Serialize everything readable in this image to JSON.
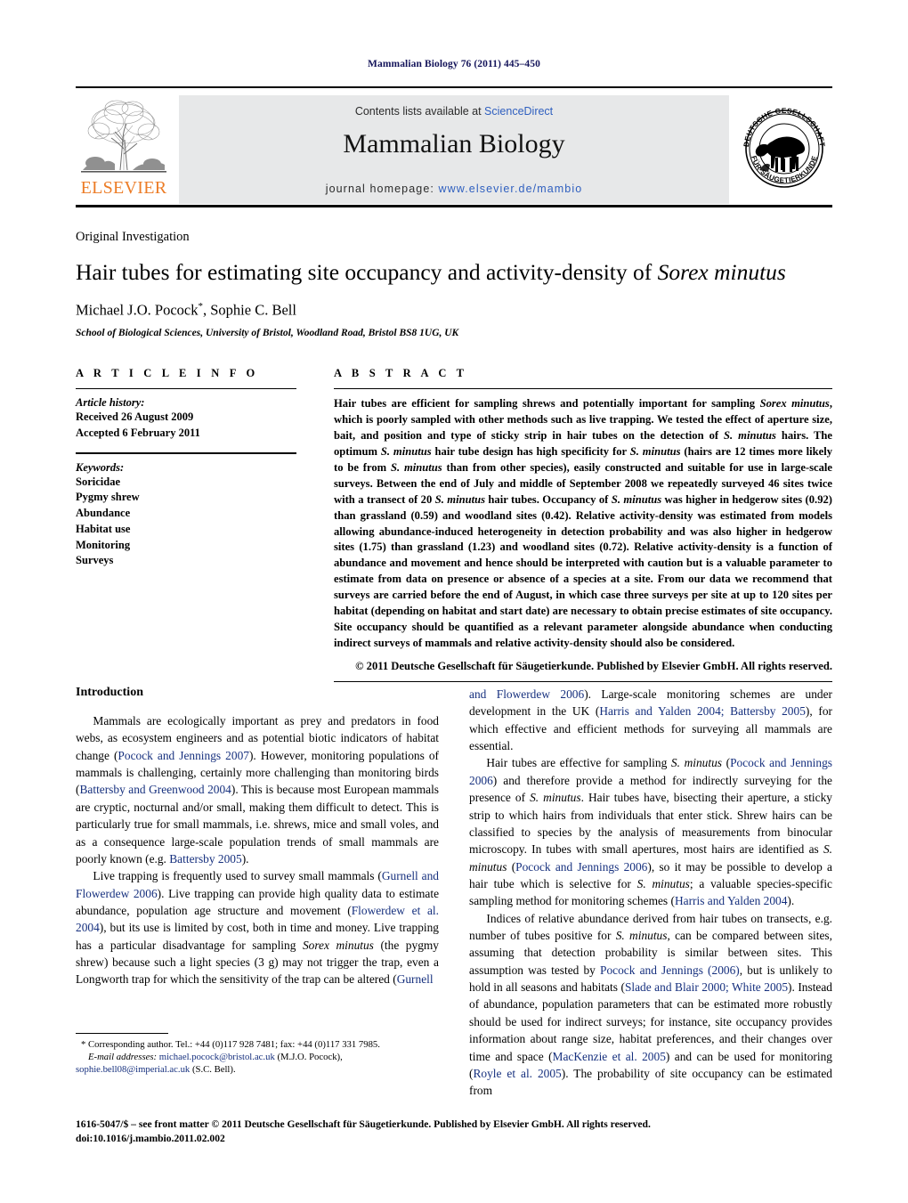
{
  "running_head": "Mammalian Biology 76 (2011) 445–450",
  "masthead": {
    "contents_prefix": "Contents lists available at ",
    "contents_link": "ScienceDirect",
    "journal_title": "Mammalian Biology",
    "homepage_prefix": "journal homepage: ",
    "homepage_url": "www.elsevier.de/mambio",
    "publisher_name": "ELSEVIER",
    "publisher_logo_icon": "elsevier-tree-icon",
    "society_logo_icon": "deutsche-gesellschaft-fuer-saeugetierkunde-seal-icon",
    "society_text_top": "DEUTSCHE GESELLSCHAFT",
    "society_text_bottom": "FÜR SÄUGETIERKUNDE",
    "band_color": "#e7e8e9",
    "link_color": "#2f5fbf",
    "elsevier_orange": "#ec7c26"
  },
  "title_block": {
    "article_type": "Original Investigation",
    "title_plain_1": "Hair tubes for estimating site occupancy and activity-density of ",
    "title_italic": "Sorex minutus",
    "authors": "Michael J.O. Pocock",
    "authors_marker": "*",
    "authors_rest": ", Sophie C. Bell",
    "affiliation": "School of Biological Sciences, University of Bristol, Woodland Road, Bristol BS8 1UG, UK"
  },
  "article_info": {
    "heading": "A R T I C L E  I N F O",
    "history_label": "Article history:",
    "history": [
      "Received 26 August 2009",
      "Accepted 6 February 2011"
    ],
    "keywords_label": "Keywords:",
    "keywords": [
      "Soricidae",
      "Pygmy shrew",
      "Abundance",
      "Habitat use",
      "Monitoring",
      "Surveys"
    ]
  },
  "abstract": {
    "heading": "A B S T R A C T",
    "segments": [
      {
        "t": "Hair tubes are efficient for sampling shrews and potentially important for sampling ",
        "i": false
      },
      {
        "t": "Sorex minutus",
        "i": true
      },
      {
        "t": ", which is poorly sampled with other methods such as live trapping. We tested the effect of aperture size, bait, and position and type of sticky strip in hair tubes on the detection of ",
        "i": false
      },
      {
        "t": "S. minutus",
        "i": true
      },
      {
        "t": " hairs. The optimum ",
        "i": false
      },
      {
        "t": "S. minutus",
        "i": true
      },
      {
        "t": " hair tube design has high specificity for ",
        "i": false
      },
      {
        "t": "S. minutus",
        "i": true
      },
      {
        "t": " (hairs are 12 times more likely to be from ",
        "i": false
      },
      {
        "t": "S. minutus",
        "i": true
      },
      {
        "t": " than from other species), easily constructed and suitable for use in large-scale surveys. Between the end of July and middle of September 2008 we repeatedly surveyed 46 sites twice with a transect of 20 ",
        "i": false
      },
      {
        "t": "S. minutus",
        "i": true
      },
      {
        "t": " hair tubes. Occupancy of ",
        "i": false
      },
      {
        "t": "S. minutus",
        "i": true
      },
      {
        "t": " was higher in hedgerow sites (0.92) than grassland (0.59) and woodland sites (0.42). Relative activity-density was estimated from models allowing abundance-induced heterogeneity in detection probability and was also higher in hedgerow sites (1.75) than grassland (1.23) and woodland sites (0.72). Relative activity-density is a function of abundance and movement and hence should be interpreted with caution but is a valuable parameter to estimate from data on presence or absence of a species at a site. From our data we recommend that surveys are carried before the end of August, in which case three surveys per site at up to 120 sites per habitat (depending on habitat and start date) are necessary to obtain precise estimates of site occupancy. Site occupancy should be quantified as a relevant parameter alongside abundance when conducting indirect surveys of mammals and relative activity-density should also be considered.",
        "i": false
      }
    ],
    "copyright": "© 2011 Deutsche Gesellschaft für Säugetierkunde. Published by Elsevier GmbH. All rights reserved."
  },
  "introduction": {
    "heading": "Introduction",
    "left_paragraphs": [
      [
        {
          "t": "Mammals are ecologically important as prey and predators in food webs, as ecosystem engineers and as potential biotic indicators of habitat change (",
          "k": "plain"
        },
        {
          "t": "Pocock and Jennings 2007",
          "k": "cite"
        },
        {
          "t": "). However, monitoring populations of mammals is challenging, certainly more challenging than monitoring birds (",
          "k": "plain"
        },
        {
          "t": "Battersby and Greenwood 2004",
          "k": "cite"
        },
        {
          "t": "). This is because most European mammals are cryptic, nocturnal and/or small, making them difficult to detect. This is particularly true for small mammals, i.e. shrews, mice and small voles, and as a consequence large-scale population trends of small mammals are poorly known (e.g. ",
          "k": "plain"
        },
        {
          "t": "Battersby 2005",
          "k": "cite"
        },
        {
          "t": ").",
          "k": "plain"
        }
      ],
      [
        {
          "t": "Live trapping is frequently used to survey small mammals (",
          "k": "plain"
        },
        {
          "t": "Gurnell and Flowerdew 2006",
          "k": "cite"
        },
        {
          "t": "). Live trapping can provide high quality data to estimate abundance, population age structure and movement (",
          "k": "plain"
        },
        {
          "t": "Flowerdew et al. 2004",
          "k": "cite"
        },
        {
          "t": "), but its use is limited by cost, both in time and money. Live trapping has a particular disadvantage for sampling ",
          "k": "plain"
        },
        {
          "t": "Sorex minutus",
          "k": "italic"
        },
        {
          "t": " (the pygmy shrew) because such a light species (3 g) may not trigger the trap, even a Longworth trap for which the sensitivity of the trap can be altered (",
          "k": "plain"
        },
        {
          "t": "Gurnell",
          "k": "cite"
        }
      ]
    ],
    "right_paragraphs": [
      [
        {
          "t": "and Flowerdew 2006",
          "k": "cite"
        },
        {
          "t": "). Large-scale monitoring schemes are under development in the UK (",
          "k": "plain"
        },
        {
          "t": "Harris and Yalden 2004; Battersby 2005",
          "k": "cite"
        },
        {
          "t": "), for which effective and efficient methods for surveying all mammals are essential.",
          "k": "plain"
        }
      ],
      [
        {
          "t": "Hair tubes are effective for sampling ",
          "k": "plain"
        },
        {
          "t": "S. minutus",
          "k": "italic"
        },
        {
          "t": " (",
          "k": "plain"
        },
        {
          "t": "Pocock and Jennings 2006",
          "k": "cite"
        },
        {
          "t": ") and therefore provide a method for indirectly surveying for the presence of ",
          "k": "plain"
        },
        {
          "t": "S. minutus",
          "k": "italic"
        },
        {
          "t": ". Hair tubes have, bisecting their aperture, a sticky strip to which hairs from individuals that enter stick. Shrew hairs can be classified to species by the analysis of measurements from binocular microscopy. In tubes with small apertures, most hairs are identified as ",
          "k": "plain"
        },
        {
          "t": "S. minutus",
          "k": "italic"
        },
        {
          "t": " (",
          "k": "plain"
        },
        {
          "t": "Pocock and Jennings 2006",
          "k": "cite"
        },
        {
          "t": "), so it may be possible to develop a hair tube which is selective for ",
          "k": "plain"
        },
        {
          "t": "S. minutus",
          "k": "italic"
        },
        {
          "t": "; a valuable species-specific sampling method for monitoring schemes (",
          "k": "plain"
        },
        {
          "t": "Harris and Yalden 2004",
          "k": "cite"
        },
        {
          "t": ").",
          "k": "plain"
        }
      ],
      [
        {
          "t": "Indices of relative abundance derived from hair tubes on transects, e.g. number of tubes positive for ",
          "k": "plain"
        },
        {
          "t": "S. minutus",
          "k": "italic"
        },
        {
          "t": ", can be compared between sites, assuming that detection probability is similar between sites. This assumption was tested by ",
          "k": "plain"
        },
        {
          "t": "Pocock and Jennings (2006)",
          "k": "cite"
        },
        {
          "t": ", but is unlikely to hold in all seasons and habitats (",
          "k": "plain"
        },
        {
          "t": "Slade and Blair 2000; White 2005",
          "k": "cite"
        },
        {
          "t": "). Instead of abundance, population parameters that can be estimated more robustly should be used for indirect surveys; for instance, site occupancy provides information about range size, habitat preferences, and their changes over time and space (",
          "k": "plain"
        },
        {
          "t": "MacKenzie et al. 2005",
          "k": "cite"
        },
        {
          "t": ") and can be used for monitoring (",
          "k": "plain"
        },
        {
          "t": "Royle et al. 2005",
          "k": "cite"
        },
        {
          "t": "). The probability of site occupancy can be estimated from",
          "k": "plain"
        }
      ]
    ]
  },
  "footnotes": {
    "corresponding_marker": "*",
    "corresponding": "Corresponding author. Tel.: +44 (0)117 928 7481; fax: +44 (0)117 331 7985.",
    "email_label": "E-mail addresses:",
    "email_1": "michael.pocock@bristol.ac.uk",
    "email_1_owner": "(M.J.O. Pocock),",
    "email_2": "sophie.bell08@imperial.ac.uk",
    "email_2_owner": "(S.C. Bell)."
  },
  "imprint": {
    "line_1": "1616-5047/$ – see front matter © 2011 Deutsche Gesellschaft für Säugetierkunde. Published by Elsevier GmbH. All rights reserved.",
    "line_2": "doi:10.1016/j.mambio.2011.02.002"
  }
}
